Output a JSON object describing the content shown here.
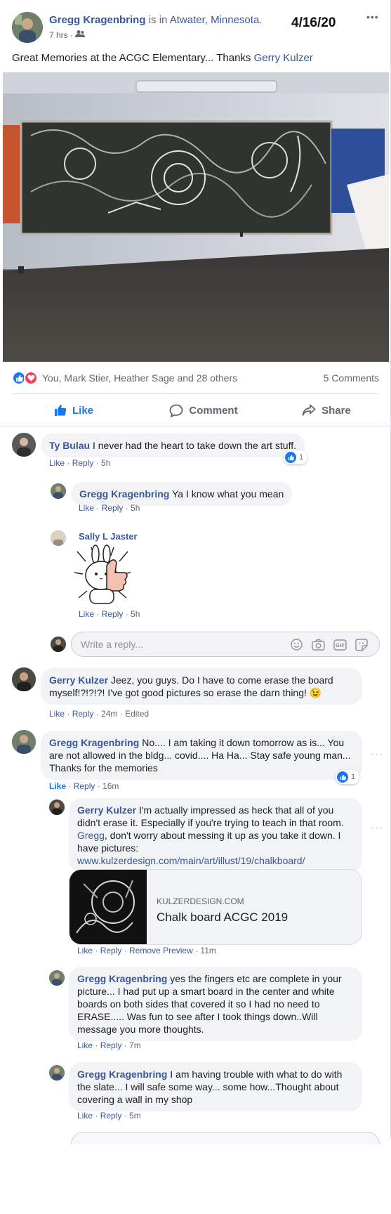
{
  "post": {
    "author": "Gregg Kragenbring",
    "is_in": "is in",
    "location": "Atwater, Minnesota.",
    "time": "7 hrs",
    "handwritten_date": "4/16/20",
    "text": "Great Memories at the ACGC Elementary... Thanks",
    "tagged": "Gerry Kulzer",
    "more_label": "•••"
  },
  "reactions": {
    "names": "You, Mark Stier, Heather Sage and 28 others",
    "comments_count": "5 Comments"
  },
  "action_bar": {
    "like": "Like",
    "comment": "Comment",
    "share": "Share"
  },
  "comments": [
    {
      "author": "Ty Bulau",
      "text": "I never had the heart to take down the art stuff.",
      "like": "Like",
      "reply": "Reply",
      "time": "5h",
      "reaction_count": "1"
    },
    {
      "author": "Gregg Kragenbring",
      "text": "Ya I know what you mean",
      "like": "Like",
      "reply": "Reply",
      "time": "5h"
    },
    {
      "author": "Sally L Jaster",
      "like": "Like",
      "reply": "Reply",
      "time": "5h"
    },
    {
      "author": "Gerry Kulzer",
      "text": "Jeez, you guys. Do I have to come erase the board myself!?!?!?! I've got good pictures so erase the darn thing! 😉",
      "like": "Like",
      "reply": "Reply",
      "time": "24m",
      "edited": "Edited"
    },
    {
      "author": "Gregg Kragenbring",
      "text": "No.... I am taking it down tomorrow as is... You are not allowed in the bldg... covid.... Ha Ha... Stay safe young man... Thanks for the memories",
      "like": "Like",
      "reply": "Reply",
      "time": "16m",
      "reaction_count": "1"
    },
    {
      "author": "Gerry Kulzer",
      "text_a": "I'm actually impressed as heck that all of you didn't erase it. Especially if you're trying to teach in that room.",
      "mention": "Gregg",
      "text_b": ", don't worry about messing it up as you take it down. I have pictures:",
      "url": "www.kulzerdesign.com/main/art/illust/19/chalkboard/",
      "preview_domain": "KULZERDESIGN.COM",
      "preview_title": "Chalk board ACGC 2019",
      "like": "Like",
      "reply": "Reply",
      "remove_preview": "Remove Preview",
      "time": "11m"
    },
    {
      "author": "Gregg Kragenbring",
      "text": "yes the fingers etc are complete in your picture... I had put up a smart board in the center and white boards on both sides that covered it so I had no need to ERASE..... Was fun to see after I took things down..Will message you more thoughts.",
      "like": "Like",
      "reply": "Reply",
      "time": "7m"
    },
    {
      "author": "Gregg Kragenbring",
      "text": "I am having trouble with what to do with the slate... I will safe some way... some how...Thought about covering a wall in my shop",
      "like": "Like",
      "reply": "Reply",
      "time": "5m"
    }
  ],
  "reply_box": {
    "placeholder": "Write a reply..."
  },
  "colors": {
    "link": "#385898",
    "like_blue": "#1877f2",
    "love_red": "#f33e58",
    "bubble": "#f2f3f5",
    "meta": "#606770"
  },
  "icons": [
    "globe-friends-icon",
    "like-icon",
    "love-icon",
    "comment-icon",
    "share-icon",
    "emoji-icon",
    "camera-icon",
    "gif-icon",
    "sticker-icon",
    "more-icon"
  ]
}
